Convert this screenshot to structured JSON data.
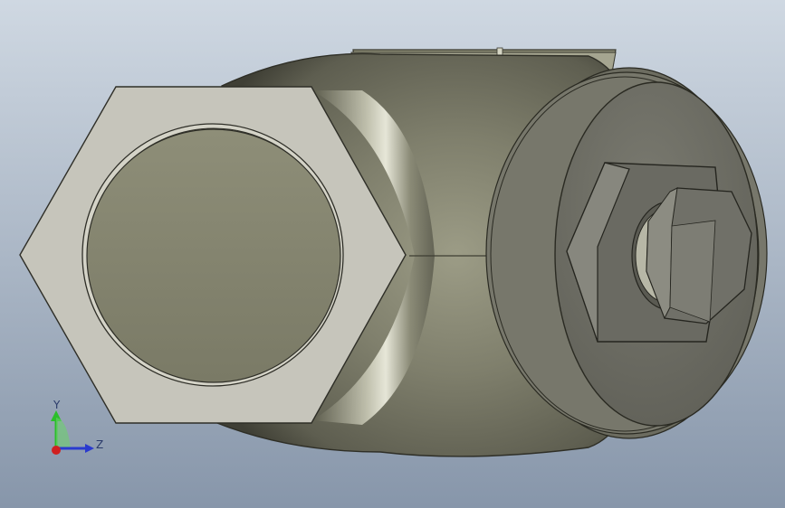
{
  "viewport": {
    "background_top": "#c9d3de",
    "background_bottom": "#8b99ac"
  },
  "model": {
    "body_color": "#7d7d6c",
    "hex_nut_color": "#c6c5bb",
    "bore_color": "#878771",
    "cap_color": "#6f6f66",
    "bolt_color": "#85857a"
  },
  "triad": {
    "y_label": "Y",
    "z_label": "Z",
    "y_color": "#2bbf2b",
    "z_color": "#2a3acf",
    "x_color": "#d02020"
  }
}
